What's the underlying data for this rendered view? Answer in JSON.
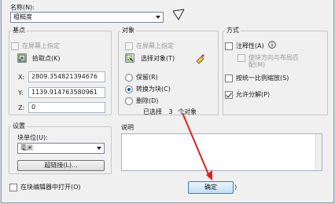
{
  "header": {
    "name_label": "名称(N):",
    "name_value": "粗糙度"
  },
  "basepoint": {
    "title": "基点",
    "specify_onscreen": "在屏幕上指定",
    "pick_point": "拾取点(K)",
    "x_label": "X:",
    "x_value": "2809.354821394676",
    "y_label": "Y:",
    "y_value": "1139.914763580961",
    "z_label": "Z:",
    "z_value": "0"
  },
  "objects": {
    "title": "对象",
    "specify_onscreen": "在屏幕上指定",
    "select_objects": "选择对象(T)",
    "retain": "保留(R)",
    "convert_to_block": "转换为块(C)",
    "delete": "删除(D)",
    "selected_prefix": "已选择",
    "selected_count": "3",
    "selected_suffix": "个对象"
  },
  "behavior": {
    "title": "方式",
    "annotative": "注释性(A)",
    "match_orientation": "使块方向与布局匹配(M)",
    "scale_uniformly": "按统一比例缩放(S)",
    "allow_exploding": "允许分解(P)"
  },
  "settings": {
    "title": "设置",
    "block_unit_label": "块单位(U):",
    "block_unit_value": "毫米",
    "hyperlink": "超链接(L)..."
  },
  "description": {
    "title": "说明"
  },
  "footer": {
    "open_in_editor": "在块编辑器中打开(O)",
    "ok": "确定",
    "partial": ")"
  },
  "colors": {
    "annotation_arrow": "#e02020"
  }
}
